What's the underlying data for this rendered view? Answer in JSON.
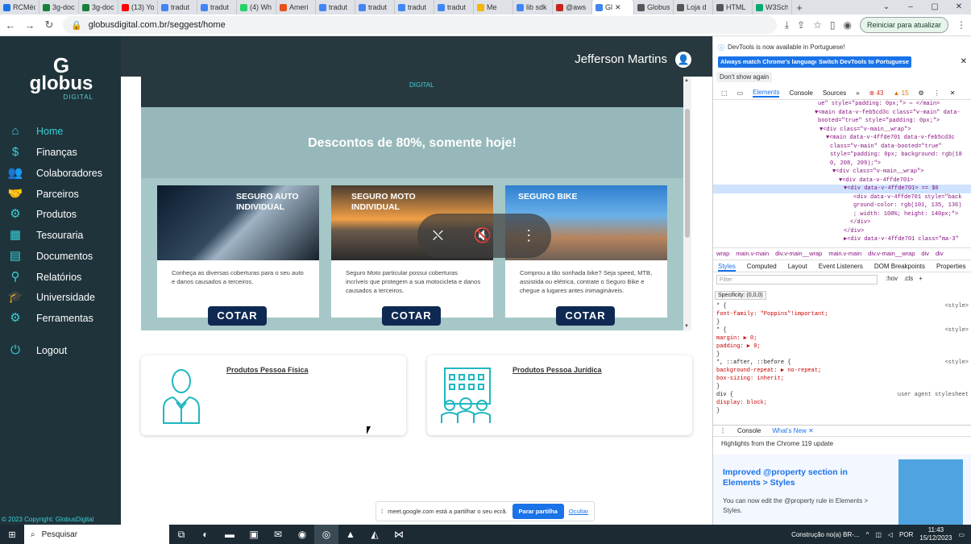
{
  "browser": {
    "tabs": [
      {
        "title": "RCMéc",
        "icon_color": "#1a73e8"
      },
      {
        "title": "3g-doc",
        "icon_color": "#188038"
      },
      {
        "title": "3g-doc",
        "icon_color": "#188038"
      },
      {
        "title": "(13) Yo",
        "icon_color": "#ff0000"
      },
      {
        "title": "tradut",
        "icon_color": "#4285f4"
      },
      {
        "title": "tradut",
        "icon_color": "#4285f4"
      },
      {
        "title": "(4) Wh",
        "icon_color": "#25d366"
      },
      {
        "title": "Ameri",
        "icon_color": "#e94e1b"
      },
      {
        "title": "tradut",
        "icon_color": "#4285f4"
      },
      {
        "title": "tradut",
        "icon_color": "#4285f4"
      },
      {
        "title": "tradut",
        "icon_color": "#4285f4"
      },
      {
        "title": "tradut",
        "icon_color": "#4285f4"
      },
      {
        "title": "Me",
        "icon_color": "#f4b400"
      },
      {
        "title": "lib sdk",
        "icon_color": "#4285f4"
      },
      {
        "title": "@aws",
        "icon_color": "#c5221f"
      },
      {
        "title": "Gl",
        "icon_color": "#4285f4",
        "active": true
      },
      {
        "title": "Globus",
        "icon_color": "#555555"
      },
      {
        "title": "Loja d",
        "icon_color": "#555555"
      },
      {
        "title": "HTML",
        "icon_color": "#555555"
      },
      {
        "title": "W3Sch",
        "icon_color": "#04aa6d"
      }
    ],
    "new_tab_glyph": "+",
    "url": "globusdigital.com.br/seggest/home",
    "restart_label": "Reiniciar para atualizar"
  },
  "app": {
    "logo_text": "globus",
    "logo_sub": "DIGITAL",
    "user_name": "Jefferson Martins",
    "menu": [
      {
        "label": "Home",
        "icon": "home-icon",
        "glyph": "⌂",
        "active": true
      },
      {
        "label": "Finanças",
        "icon": "finance-icon",
        "glyph": "$"
      },
      {
        "label": "Colaboradores",
        "icon": "people-icon",
        "glyph": "👥"
      },
      {
        "label": "Parceiros",
        "icon": "handshake-icon",
        "glyph": "🤝"
      },
      {
        "label": "Produtos",
        "icon": "product-icon",
        "glyph": "⚙"
      },
      {
        "label": "Tesouraria",
        "icon": "treasury-icon",
        "glyph": "▦"
      },
      {
        "label": "Documentos",
        "icon": "document-icon",
        "glyph": "▤"
      },
      {
        "label": "Relatórios",
        "icon": "reports-icon",
        "glyph": "⚲"
      },
      {
        "label": "Universidade",
        "icon": "university-icon",
        "glyph": "🎓"
      },
      {
        "label": "Ferramentas",
        "icon": "tools-icon",
        "glyph": "⚙"
      },
      {
        "label": "Logout",
        "icon": "power-icon",
        "glyph": "⏻"
      }
    ],
    "copyright": "© 2023 Copyright: GlobusDigital"
  },
  "banner": {
    "sub": "DIGITAL",
    "promo": "Descontos de 80%, somente hoje!",
    "cards": [
      {
        "title": "SEGURO AUTO INDIVIDUAL",
        "desc": "Conheça as diversas coberturas para o seu auto e danos causados a terceiros.",
        "button": "COTAR"
      },
      {
        "title": "SEGURO MOTO INDIVIDUAL",
        "desc": "Seguro Moto particular possui coberturas incríveis que protegem a sua motocicleta e danos causados a terceiros.",
        "button": "COTAR"
      },
      {
        "title": "SEGURO BIKE",
        "desc": "Comprou a tão sonhada bike? Seja speed, MTB, assistida ou elétrica, contrate o Seguro Bike e chegue a lugares antes inimagináveis.",
        "button": "COTAR"
      }
    ]
  },
  "products": {
    "pf": "Produtos Pessoa Física",
    "pj": "Produtos Pessoa Jurídica"
  },
  "meet": {
    "text": "meet.google.com está a partilhar o seu ecrã.",
    "stop": "Parar partilha",
    "hide": "Ocultar"
  },
  "devtools": {
    "info": "DevTools is now available in Portuguese!",
    "btn1": "Always match Chrome's language",
    "btn2": "Switch DevTools to Portuguese",
    "dont_show": "Don't show again",
    "tabs": [
      "Elements",
      "Console",
      "Sources",
      "»"
    ],
    "errors": "43",
    "warnings": "15",
    "dom_lines": [
      "ue\" style=\"padding: 0px;\"> ⋯ </main>",
      "▼<main data-v-feb5cd3c class=\"v-main\" data-",
      "booted=\"true\" style=\"padding: 0px;\">",
      "▼<div class=\"v-main__wrap\">",
      "▼<main data-v-4ffde701 data-v-feb5cd3c",
      "class=\"v-main\" data-booted=\"true\"",
      "style=\"padding: 0px; background: rgb(18",
      "0, 208, 209);\">",
      "▼<div class=\"v-main__wrap\">",
      "▼<div data-v-4ffde701>",
      "▼<div data-v-4ffde701> == $0",
      "<div data-v-4ffde701 style=\"back",
      "ground-color: rgb(101, 135, 136)",
      "; width: 100%; height: 140px;\">",
      "</div>",
      "</div>",
      "▶<div data-v-4ffde701 class=\"ma-3\""
    ],
    "crumbs": [
      "wrap",
      "main.v-main",
      "div.v-main__wrap",
      "main.v-main",
      "div.v-main__wrap",
      "div",
      "div"
    ],
    "style_tabs": [
      "Styles",
      "Computed",
      "Layout",
      "Event Listeners",
      "DOM Breakpoints",
      "Properties"
    ],
    "filter_placeholder": "Filter",
    "filter_tools": [
      ":hov",
      ".cls",
      "+"
    ],
    "specificity": "Specificity: (0,0,0)",
    "style_lines": [
      {
        "t": "* {",
        "src": "<style>"
      },
      {
        "t": "  font-family: \"Poppins\"!important;",
        "prop": true
      },
      {
        "t": "}"
      },
      {
        "t": "* {",
        "src": "<style>"
      },
      {
        "t": "  margin: ▶ 0;",
        "prop": true
      },
      {
        "t": "  padding: ▶ 0;",
        "prop": true
      },
      {
        "t": "}"
      },
      {
        "t": "*, ::after, ::before {",
        "src": "<style>"
      },
      {
        "t": "  background-repeat: ▶ no-repeat;",
        "prop": true
      },
      {
        "t": "  box-sizing: inherit;",
        "prop": true
      },
      {
        "t": "}"
      },
      {
        "t": "div {",
        "src": "user agent stylesheet"
      },
      {
        "t": "  display: block;",
        "prop": true
      },
      {
        "t": "}"
      }
    ],
    "drawer_tabs": [
      "Console",
      "What's New"
    ],
    "highlights": "Highlights from the Chrome 119 update",
    "news_title": "Improved @property section in Elements > Styles",
    "news_text": "You can now edit the @property rule in Elements > Styles."
  },
  "taskbar": {
    "search": "Pesquisar",
    "notification": "Construção no(a) BR-...",
    "lang": "POR",
    "time": "11:43",
    "date": "15/12/2023"
  }
}
